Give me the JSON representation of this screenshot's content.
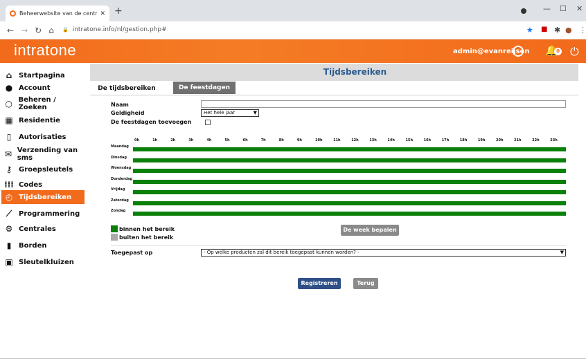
{
  "browser": {
    "tab_title": "Beheerwebsite van de centrales",
    "url": "intratone.info/nl/gestion.php#"
  },
  "header": {
    "logo": "intratone",
    "user": "admin@evanreijsen",
    "notifications": "0"
  },
  "sidebar": {
    "items": [
      {
        "label": "Startpagina",
        "icon": "home-icon"
      },
      {
        "label": "Account",
        "icon": "user-icon"
      },
      {
        "label": "Beheren / Zoeken",
        "icon": "search-icon"
      },
      {
        "label": "Residentie",
        "icon": "building-icon"
      },
      {
        "label": "Autorisaties",
        "icon": "door-icon"
      },
      {
        "label": "Verzending van sms",
        "icon": "mail-icon"
      },
      {
        "label": "Groepsleutels",
        "icon": "key-icon"
      },
      {
        "label": "Codes",
        "icon": "keypad-icon"
      },
      {
        "label": "Tijdsbereiken",
        "icon": "calendar-clock-icon",
        "active": true
      },
      {
        "label": "Programmering",
        "icon": "wand-icon"
      },
      {
        "label": "Centrales",
        "icon": "gear-icon"
      },
      {
        "label": "Borden",
        "icon": "panel-icon"
      },
      {
        "label": "Sleutelkluizen",
        "icon": "safe-icon"
      }
    ],
    "active_color": "#f26a1b"
  },
  "main": {
    "title": "Tijdsbereiken",
    "tabs": [
      {
        "label": "De tijdsbereiken",
        "active": true
      },
      {
        "label": "De feestdagen",
        "active": false
      }
    ],
    "form": {
      "name_label": "Naam",
      "name_value": "",
      "validity_label": "Geldigheid",
      "validity_value": "Het hele jaar",
      "holidays_label": "De feestdagen toevoegen",
      "holidays_checked": false
    },
    "hours": [
      "0h",
      "1h",
      "2h",
      "3h",
      "4h",
      "5h",
      "6h",
      "7h",
      "8h",
      "9h",
      "10h",
      "11h",
      "12h",
      "13h",
      "14h",
      "15h",
      "16h",
      "17h",
      "18h",
      "19h",
      "20h",
      "21h",
      "22h",
      "23h"
    ],
    "days": [
      "Maandag",
      "Dinsdag",
      "Woensdag",
      "Donderdag",
      "Vrijdag",
      "Zaterdag",
      "Zondag"
    ],
    "in_range_fraction": 1,
    "legend": {
      "in": "binnen het bereik",
      "out": "buiten het bereik",
      "in_color": "#0a7f0a",
      "out_color": "#aaaaaa"
    },
    "define_week_button": "De week bepalen",
    "applied_label": "Toegepast op",
    "applied_value": "- Op welke producten zal dit bereik toegepast kunnen worden? -",
    "register_button": "Registreren",
    "back_button": "Terug"
  }
}
